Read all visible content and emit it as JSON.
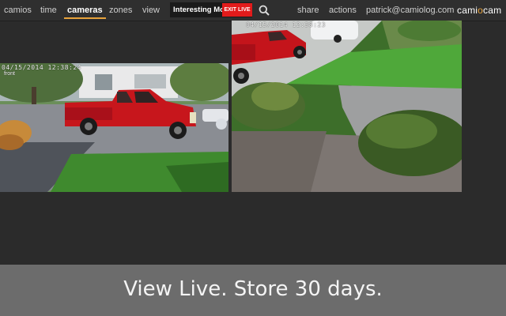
{
  "nav": {
    "items": [
      "camios",
      "time",
      "cameras",
      "zones",
      "view"
    ],
    "active": "cameras",
    "mode_label": "Interesting Mot",
    "exit_live_label": "EXIT LIVE",
    "share_label": "share",
    "actions_label": "actions",
    "user_email": "patrick@camiolog.com",
    "brand_prefix": "cami",
    "brand_accent": "o",
    "brand_suffix": "cam"
  },
  "feeds": [
    {
      "stamp": "04/15/2014 12:38:24",
      "name": "front"
    },
    {
      "stamp": "04/15/2014 12:38:23",
      "name": ""
    }
  ],
  "banner": {
    "text": "View Live. Store 30 days."
  },
  "colors": {
    "accent": "#e8a33b",
    "exit_live": "#e21b1b",
    "background": "#2b2b2b",
    "banner": "#6c6c6c"
  },
  "icons": {
    "search": "search-icon"
  }
}
